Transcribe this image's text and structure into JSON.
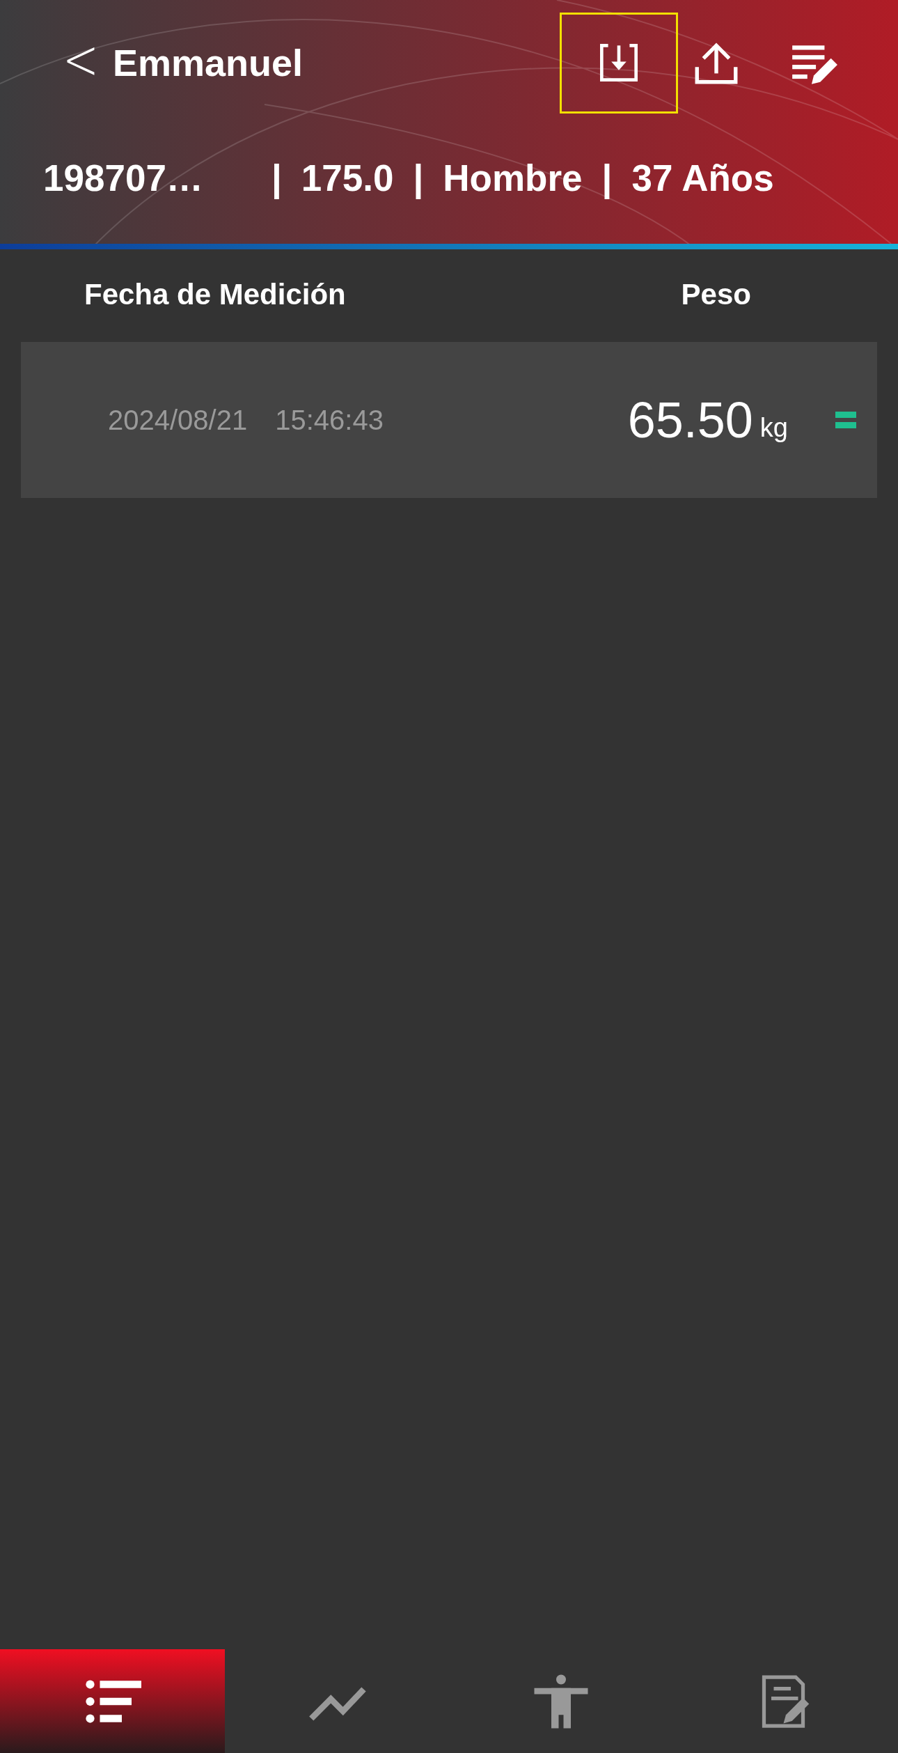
{
  "header": {
    "back": "<",
    "title": "Emmanuel",
    "actions": [
      {
        "kind": "download",
        "highlighted": true
      },
      {
        "kind": "upload",
        "highlighted": false
      },
      {
        "kind": "edit-list",
        "highlighted": false
      }
    ],
    "info": [
      {
        "kind": "text",
        "text": "198707…"
      },
      {
        "kind": "separator",
        "text": "|"
      },
      {
        "kind": "text",
        "text": "175.0"
      },
      {
        "kind": "separator",
        "text": "|"
      },
      {
        "kind": "text",
        "text": "Hombre"
      },
      {
        "kind": "separator",
        "text": "|"
      },
      {
        "kind": "text",
        "text": "37 Años"
      }
    ]
  },
  "table": {
    "columns": [
      "Fecha de Medición",
      "Peso"
    ],
    "rows": [
      {
        "date": "2024/08/21",
        "time": "15:46:43",
        "weight": "65.50",
        "unit": "kg",
        "kind": "equal",
        "color": "#1fbf8f"
      }
    ]
  },
  "tabs": [
    {
      "kind": "list",
      "selected": true
    },
    {
      "kind": "trend",
      "selected": false
    },
    {
      "kind": "body",
      "selected": false
    },
    {
      "kind": "report",
      "selected": false
    }
  ]
}
